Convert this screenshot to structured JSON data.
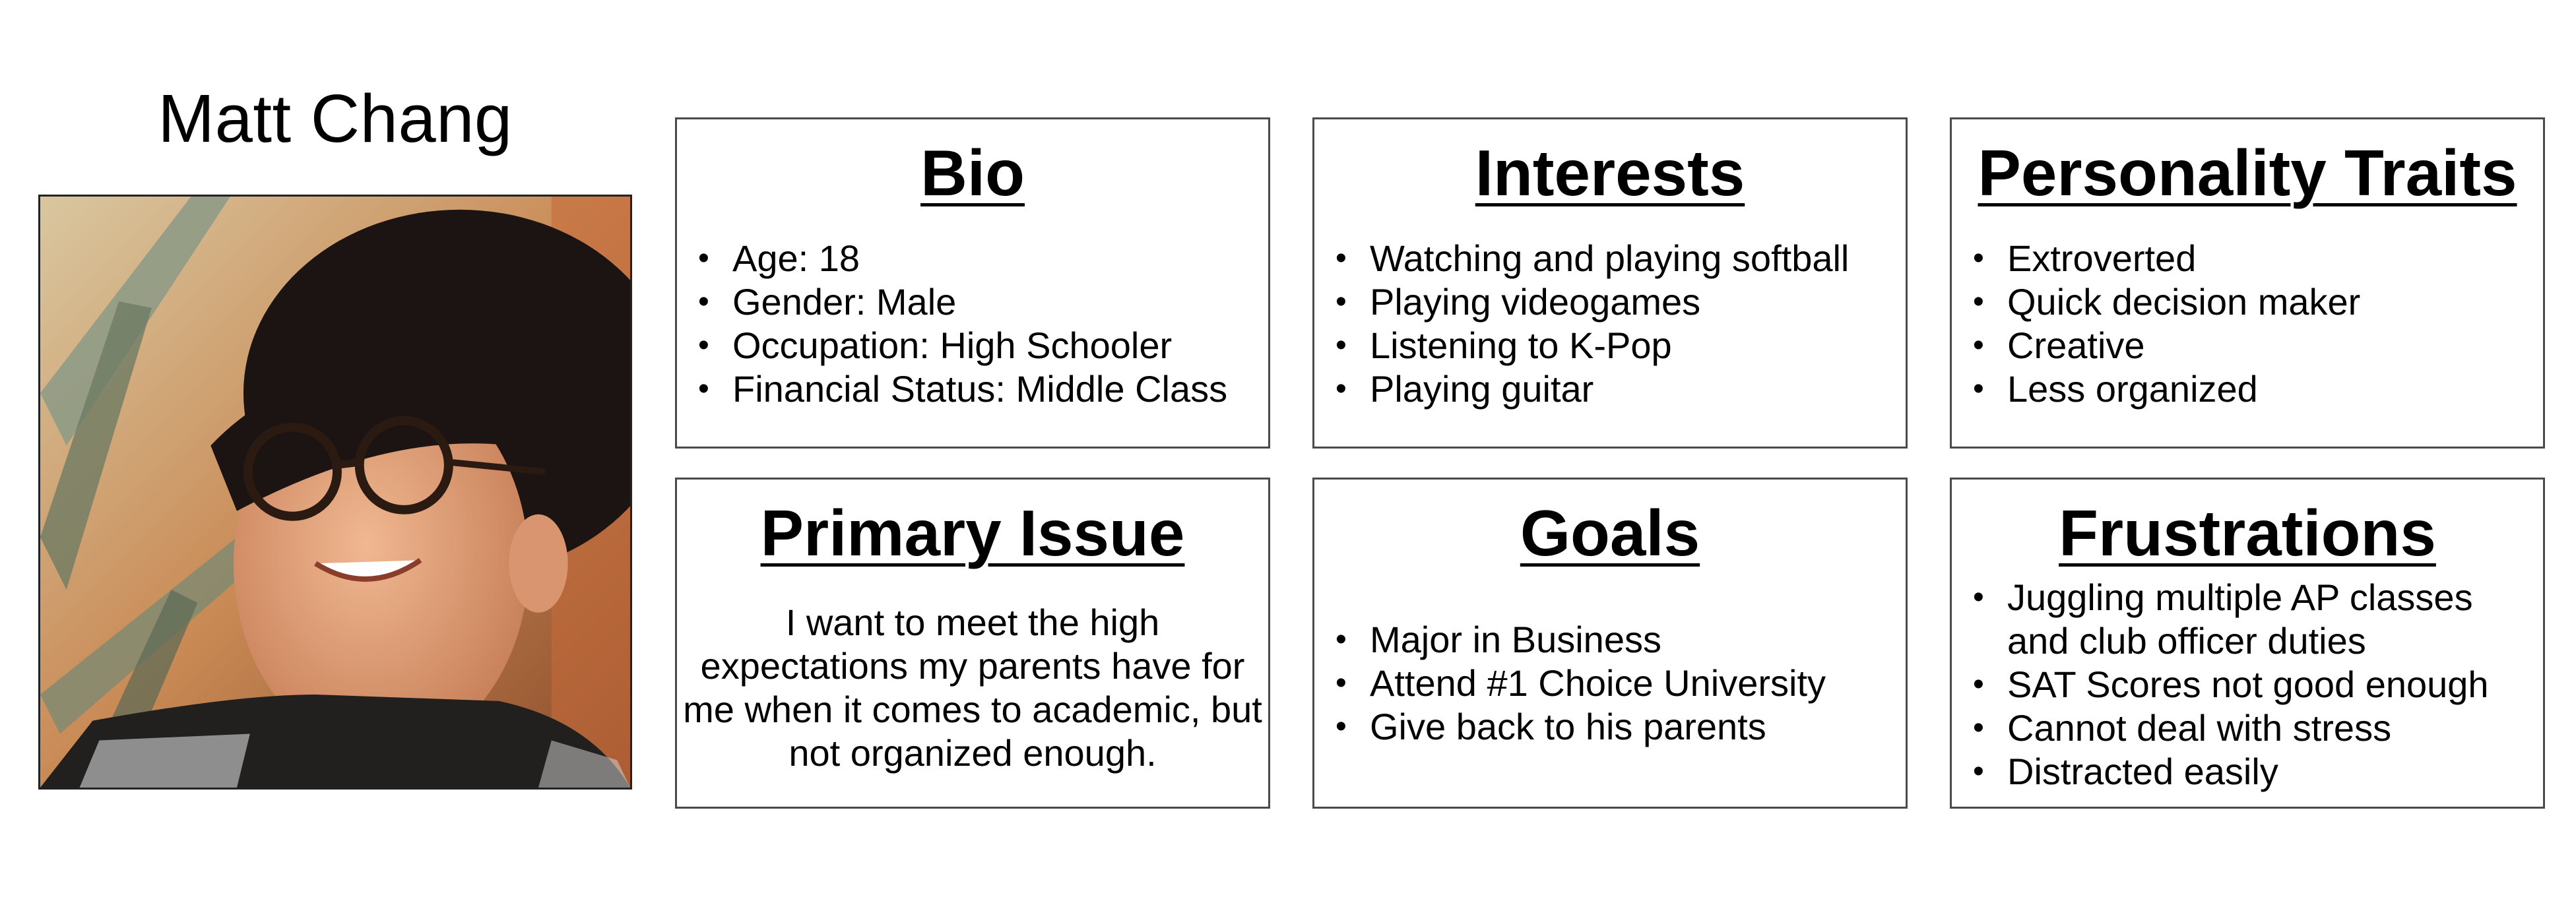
{
  "persona": {
    "name": "Matt Chang",
    "photo_desc_icon": "portrait-photo"
  },
  "bio": {
    "title": "Bio",
    "items": [
      "Age: 18",
      "Gender: Male",
      "Occupation: High Schooler",
      "Financial Status: Middle Class"
    ]
  },
  "interests": {
    "title": "Interests",
    "items": [
      "Watching and playing softball",
      "Playing videogames",
      "Listening to K-Pop",
      "Playing guitar"
    ]
  },
  "personality": {
    "title": "Personality Traits",
    "items": [
      "Extroverted",
      "Quick decision maker",
      "Creative",
      "Less organized"
    ]
  },
  "primary_issue": {
    "title": "Primary Issue",
    "text": "I want to meet the high expectations my parents have for me when it comes to academic, but not organized enough."
  },
  "goals": {
    "title": "Goals",
    "items": [
      "Major in Business",
      "Attend #1 Choice University",
      "Give back to his parents"
    ]
  },
  "frustrations": {
    "title": "Frustrations",
    "items": [
      "Juggling multiple AP classes and club officer duties",
      "SAT Scores not good enough",
      "Cannot deal with stress",
      "Distracted easily"
    ]
  }
}
